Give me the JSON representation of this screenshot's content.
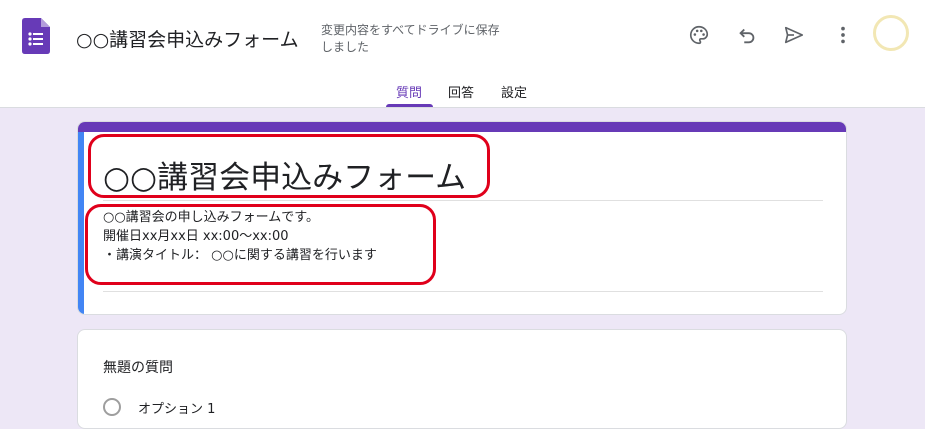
{
  "header": {
    "doc_title": "○○講習会申込みフォーム",
    "save_status": "変更内容をすべてドライブに保存しました",
    "icons": [
      "forms-app-icon",
      "palette-icon",
      "undo-icon",
      "send-icon",
      "more-vert-icon",
      "avatar"
    ]
  },
  "tabs": [
    {
      "label": "質問",
      "active": true
    },
    {
      "label": "回答",
      "active": false
    },
    {
      "label": "設定",
      "active": false
    }
  ],
  "form": {
    "title": "○○講習会申込みフォーム",
    "description_lines": [
      "○○講習会の申し込みフォームです。",
      "開催日xx月xx日 xx:00～xx:00",
      "・講演タイトル： ○○に関する講習を行います"
    ]
  },
  "question": {
    "title": "無題の質問",
    "option_label": "オプション 1"
  },
  "colors": {
    "theme": "#673ab7",
    "accent_left": "#4285f4",
    "background": "#ede7f6",
    "highlight": "#e0001b"
  }
}
